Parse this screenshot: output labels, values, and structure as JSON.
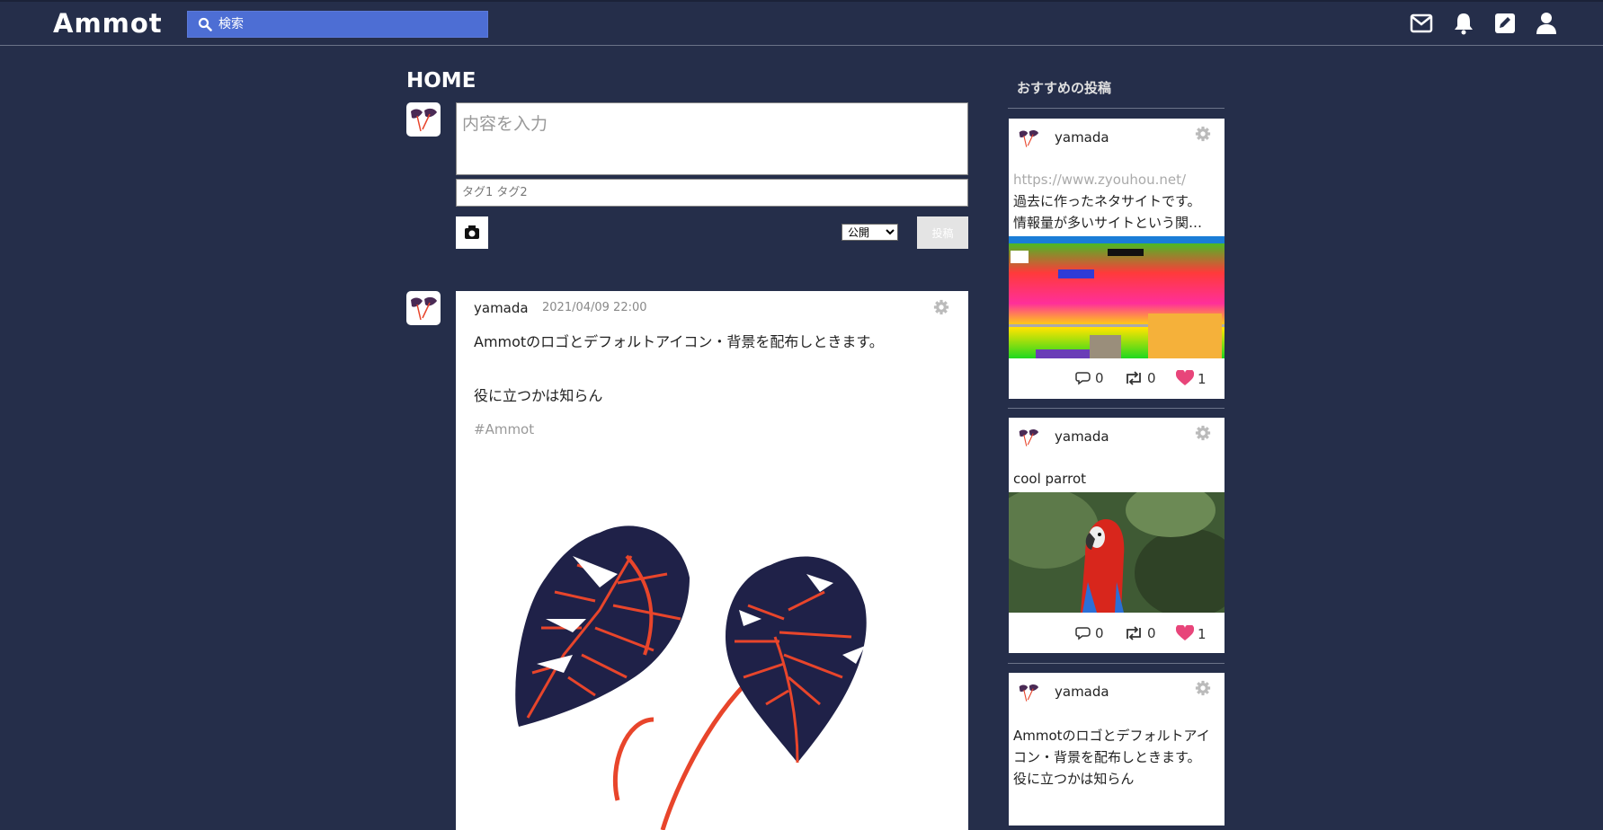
{
  "app": {
    "logo": "Ammot",
    "search": {
      "placeholder": "検索"
    },
    "header_icons": [
      "mail-icon",
      "bell-icon",
      "edit-icon",
      "user-icon"
    ]
  },
  "main": {
    "title": "HOME",
    "compose": {
      "content_placeholder": "内容を入力",
      "tags_placeholder": "タグ1 タグ2",
      "visibility": "公開",
      "visibility_options": [
        "公開"
      ],
      "post_label": "投稿"
    },
    "post": {
      "user": "yamada",
      "date": "2021/04/09 22:00",
      "line1": "Ammotのロゴとデフォルトアイコン・背景を配布しときます。",
      "line2": "役に立つかは知らん",
      "tag": "#Ammot"
    }
  },
  "sidebar": {
    "title": "おすすめの投稿",
    "cards": [
      {
        "user": "yamada",
        "link": "https://www.zyouhou.net/",
        "line1": "過去に作ったネタサイトです。",
        "line2": "情報量が多いサイトという関…",
        "comments": "0",
        "reposts": "0",
        "likes": "1"
      },
      {
        "user": "yamada",
        "line1": "cool parrot",
        "comments": "0",
        "reposts": "0",
        "likes": "1"
      },
      {
        "user": "yamada",
        "line1": "Ammotのロゴとデフォルトアイ",
        "line2": "コン・背景を配布しときます。",
        "line3": "役に立つかは知らん"
      }
    ]
  },
  "colors": {
    "background": "#252e4a",
    "search": "#4d6ed4",
    "like": "#e8457a",
    "leaf": "#1f2148",
    "vein": "#e8452b"
  }
}
